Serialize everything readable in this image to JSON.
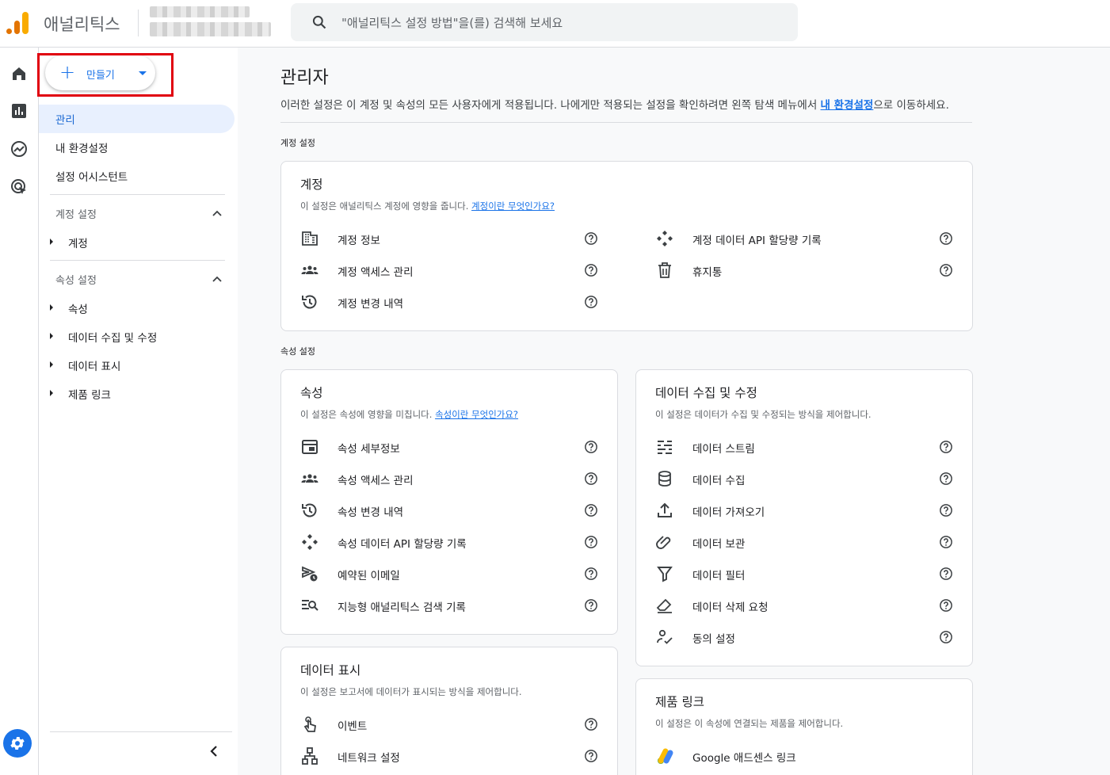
{
  "topbar": {
    "app_name": "애널리틱스",
    "search_placeholder": "\"애널리틱스 설정 방법\"을(를) 검색해 보세요"
  },
  "sidenav": {
    "create_label": "만들기",
    "items": [
      {
        "label": "관리"
      },
      {
        "label": "내 환경설정"
      },
      {
        "label": "설정 어시스턴트"
      }
    ],
    "account_section": {
      "title": "계정 설정",
      "items": [
        "계정"
      ]
    },
    "property_section": {
      "title": "속성 설정",
      "items": [
        "속성",
        "데이터 수집 및 수정",
        "데이터 표시",
        "제품 링크"
      ]
    }
  },
  "main": {
    "title": "관리자",
    "desc_prefix": "이러한 설정은 이 계정 및 속성의 모든 사용자에게 적용됩니다. 나에게만 적용되는 설정을 확인하려면 왼쪽 탐색 메뉴에서 ",
    "desc_link": "내 환경설정",
    "desc_suffix": "으로 이동하세요.",
    "account_label": "계정 설정",
    "property_label": "속성 설정",
    "cards": {
      "account": {
        "title": "계정",
        "desc": "이 설정은 애널리틱스 계정에 영향을 줍니다. ",
        "link": "계정이란 무엇인가요?",
        "rows": [
          "계정 정보",
          "계정 액세스 관리",
          "계정 변경 내역",
          "계정 데이터 API 할당량 기록",
          "휴지통"
        ]
      },
      "property": {
        "title": "속성",
        "desc": "이 설정은 속성에 영향을 미칩니다. ",
        "link": "속성이란 무엇인가요?",
        "rows": [
          "속성 세부정보",
          "속성 액세스 관리",
          "속성 변경 내역",
          "속성 데이터 API 할당량 기록",
          "예약된 이메일",
          "지능형 애널리틱스 검색 기록"
        ]
      },
      "data_collection": {
        "title": "데이터 수집 및 수정",
        "desc": "이 설정은 데이터가 수집 및 수정되는 방식을 제어합니다.",
        "rows": [
          "데이터 스트림",
          "데이터 수집",
          "데이터 가져오기",
          "데이터 보관",
          "데이터 필터",
          "데이터 삭제 요청",
          "동의 설정"
        ]
      },
      "data_display": {
        "title": "데이터 표시",
        "desc": "이 설정은 보고서에 데이터가 표시되는 방식을 제어합니다.",
        "rows": [
          "이벤트",
          "네트워크 설정"
        ]
      },
      "product_links": {
        "title": "제품 링크",
        "desc": "이 설정은 이 속성에 연결되는 제품을 제어합니다.",
        "rows": [
          "Google 애드센스 링크"
        ]
      }
    }
  },
  "colors": {
    "accent": "#1a73e8",
    "highlight_box": "#e0000f",
    "logo_orange": "#e37400",
    "logo_yellow": "#f9ab00"
  }
}
